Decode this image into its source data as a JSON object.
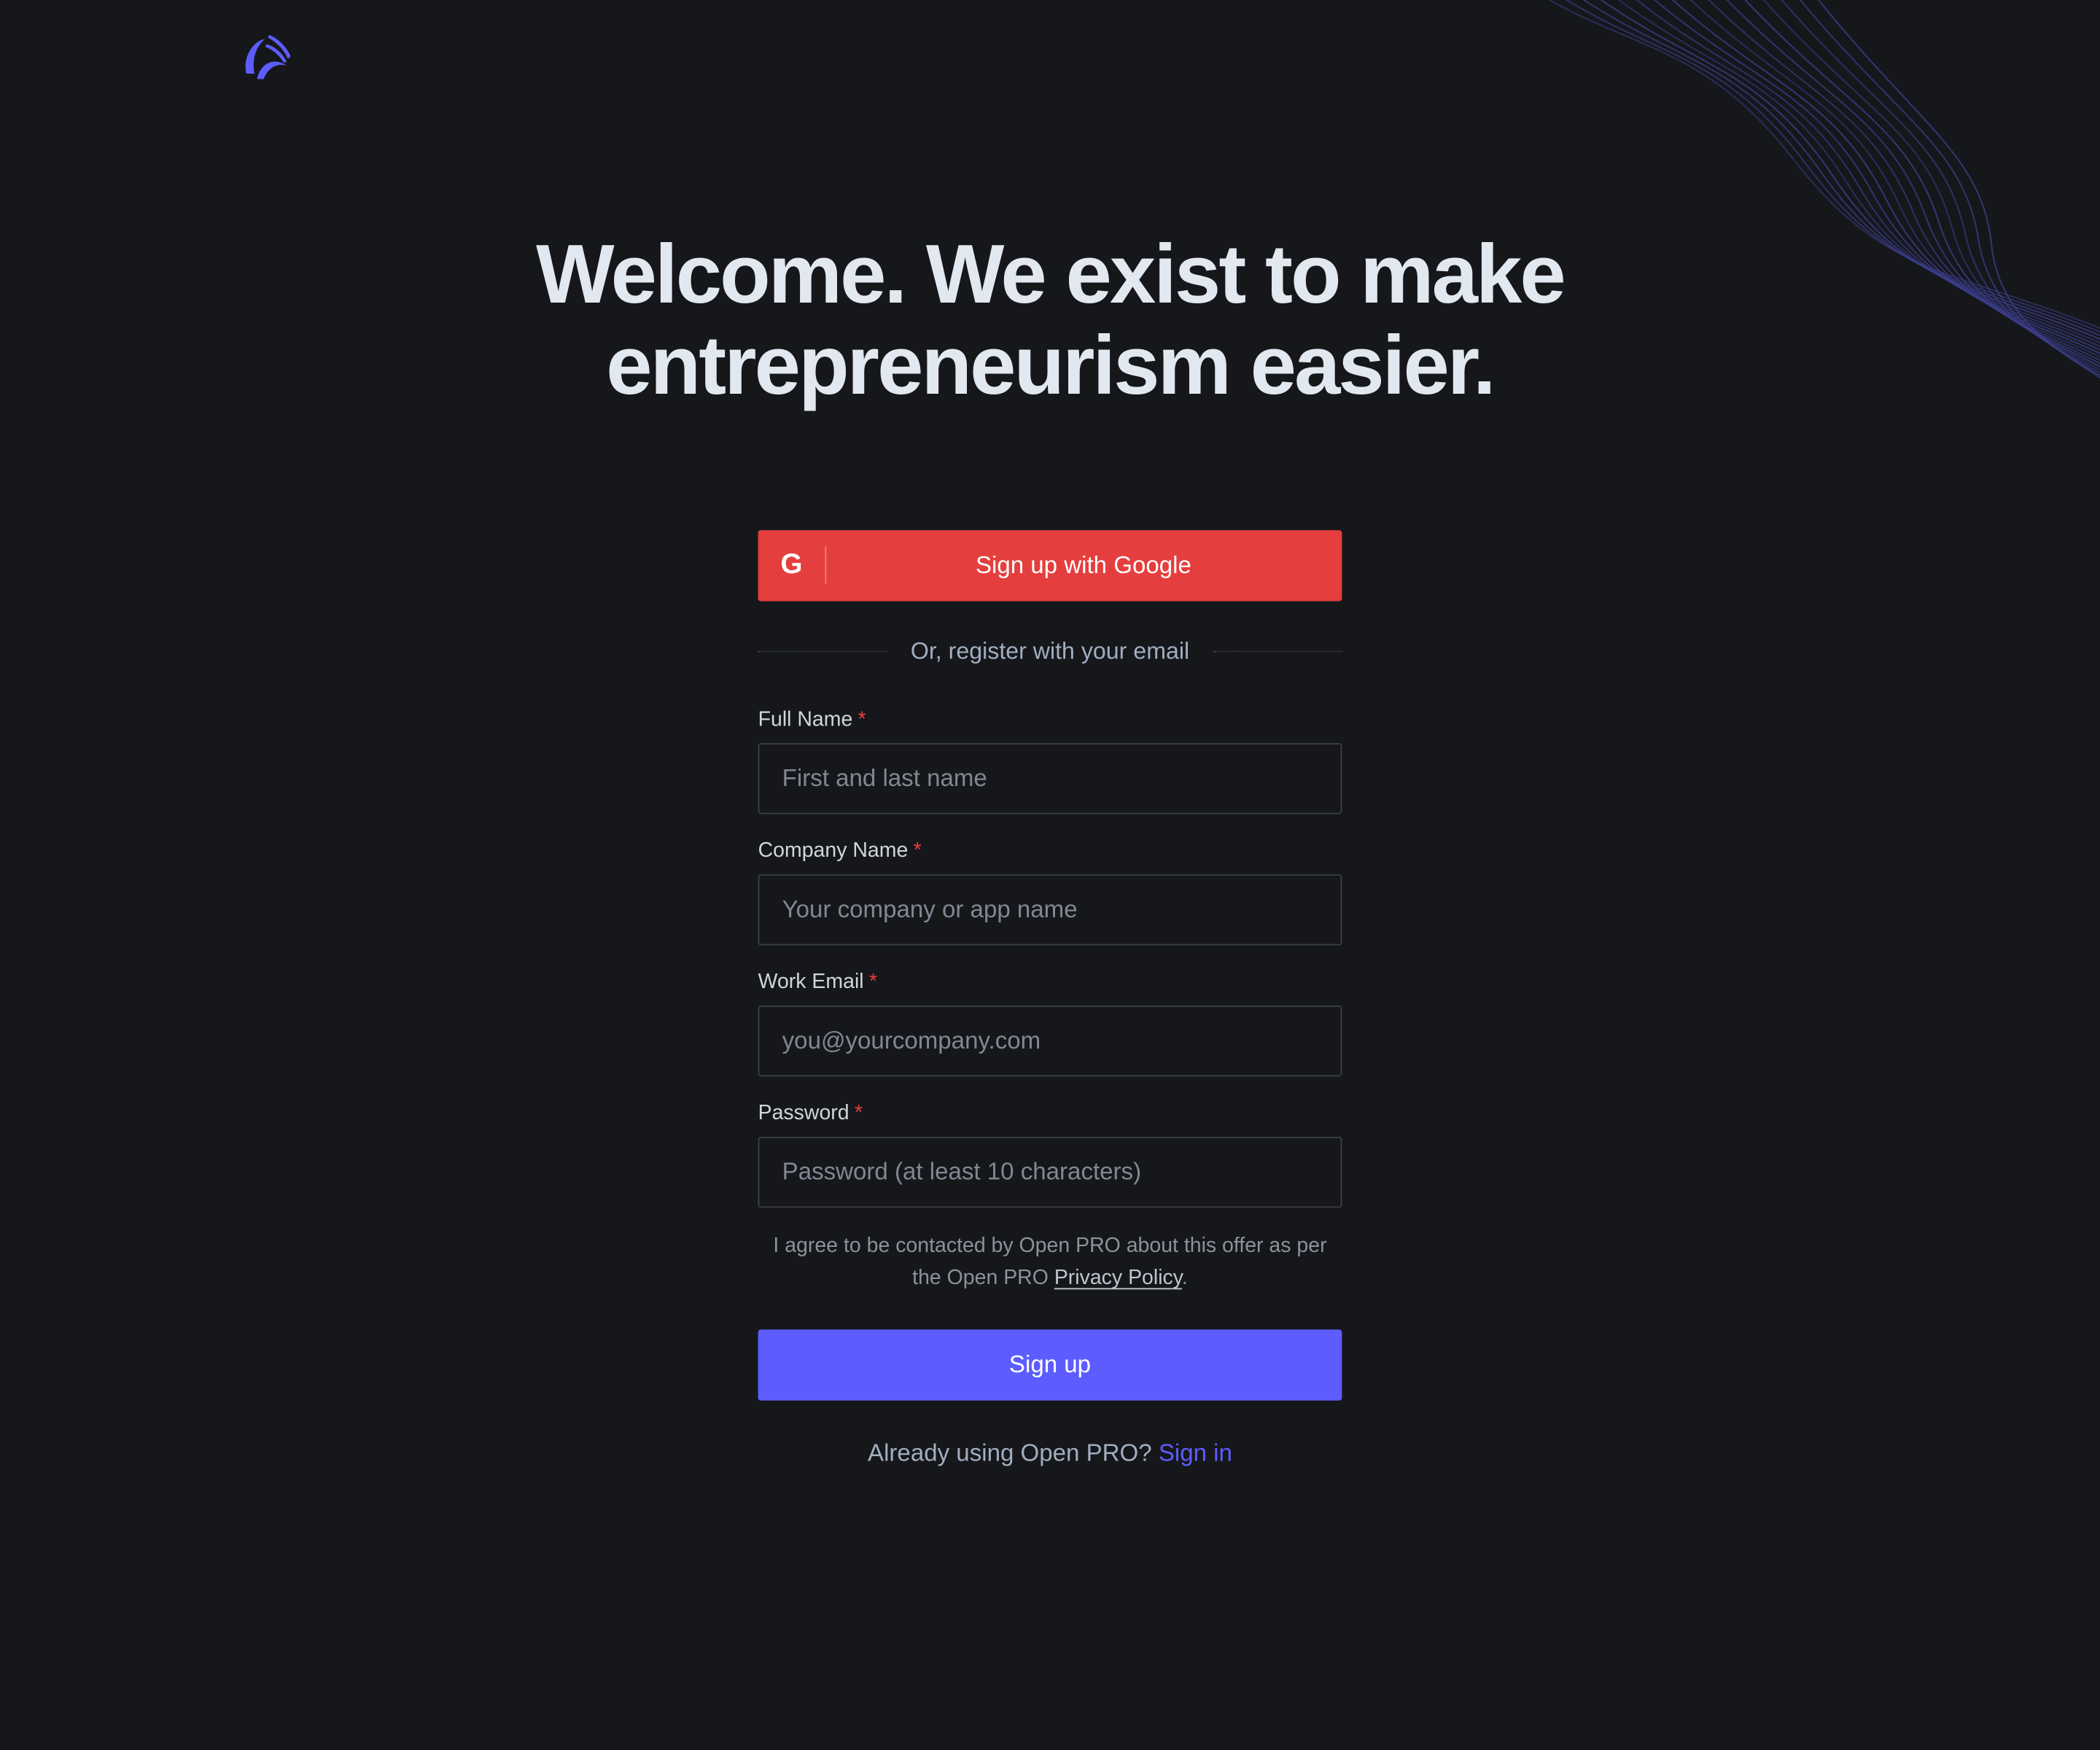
{
  "brand": {
    "logo_icon": "open-pro-logo-icon",
    "accent_color": "#5D5DFF"
  },
  "hero": {
    "headline_line1": "Welcome. We exist to make",
    "headline_line2": "entrepreneurism easier."
  },
  "google_signup": {
    "icon": "google-g-icon",
    "icon_glyph": "G",
    "label": "Sign up with Google",
    "color": "#E53E3E"
  },
  "divider_text": "Or, register with your email",
  "fields": {
    "full_name": {
      "label": "Full Name",
      "required_mark": "*",
      "placeholder": "First and last name",
      "value": ""
    },
    "company_name": {
      "label": "Company Name",
      "required_mark": "*",
      "placeholder": "Your company or app name",
      "value": ""
    },
    "work_email": {
      "label": "Work Email",
      "required_mark": "*",
      "placeholder": "you@yourcompany.com",
      "value": ""
    },
    "password": {
      "label": "Password",
      "required_mark": "*",
      "placeholder": "Password (at least 10 characters)",
      "value": ""
    }
  },
  "consent": {
    "text_before": "I agree to be contacted by Open PRO about this offer as per the Open PRO ",
    "link_label": "Privacy Policy",
    "text_after": "."
  },
  "signup_button": {
    "label": "Sign up"
  },
  "signin_prompt": {
    "text": "Already using Open PRO? ",
    "link_label": "Sign in"
  }
}
